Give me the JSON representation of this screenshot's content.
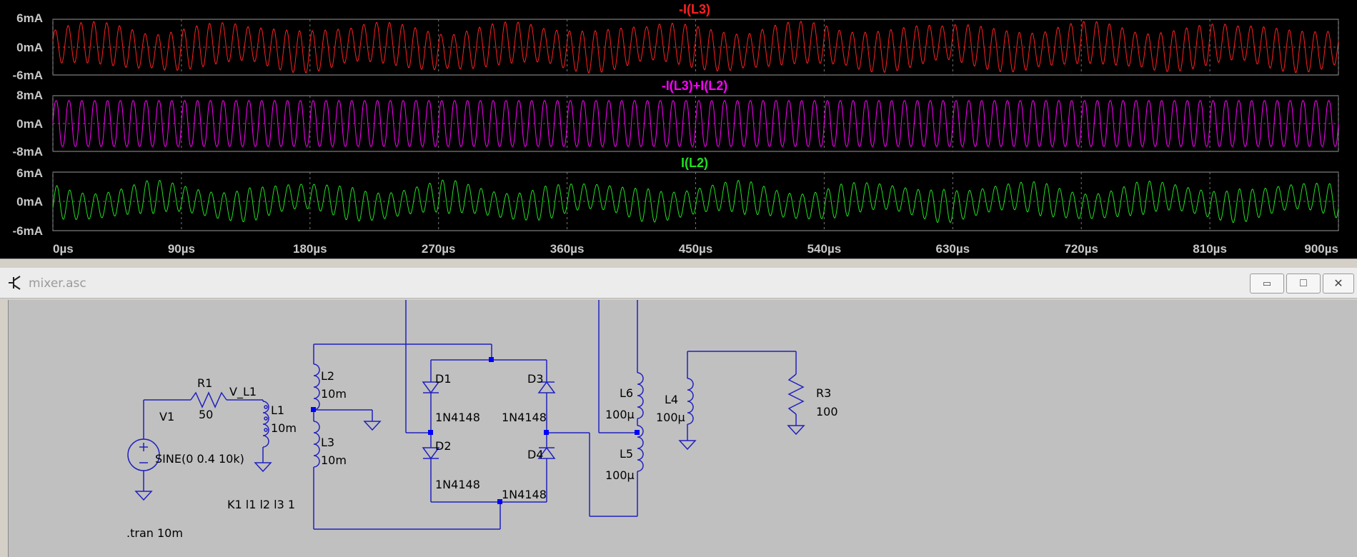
{
  "waveform": {
    "traces": [
      {
        "name": "-I(L3)",
        "color": "#ff2020",
        "y_ticks": [
          "6mA",
          "0mA",
          "-6mA"
        ],
        "amplitude_mA": 6
      },
      {
        "name": "-I(L3)+I(L2)",
        "color": "#ff00ff",
        "y_ticks": [
          "8mA",
          "0mA",
          "-8mA"
        ],
        "amplitude_mA": 8
      },
      {
        "name": "I(L2)",
        "color": "#20e020",
        "y_ticks": [
          "6mA",
          "0mA",
          "-6mA"
        ],
        "amplitude_mA": 6
      }
    ],
    "x_ticks": [
      "0µs",
      "90µs",
      "180µs",
      "270µs",
      "360µs",
      "450µs",
      "540µs",
      "630µs",
      "720µs",
      "810µs",
      "900µs"
    ],
    "x_range_us": [
      0,
      900
    ],
    "grid": "dashed"
  },
  "schematic_window": {
    "title": "mixer.asc",
    "buttons": {
      "minimize": "▭",
      "maximize": "□",
      "close": "✕"
    }
  },
  "schematic": {
    "V1": {
      "ref": "V1",
      "value": "SINE(0 0.4 10k)"
    },
    "R1": {
      "ref": "R1",
      "value": "50"
    },
    "net_label": "V_L1",
    "L1": {
      "ref": "L1",
      "value": "10m"
    },
    "L2": {
      "ref": "L2",
      "value": "10m"
    },
    "L3": {
      "ref": "L3",
      "value": "10m"
    },
    "D1": {
      "ref": "D1",
      "value": "1N4148"
    },
    "D2": {
      "ref": "D2",
      "value": "1N4148"
    },
    "D3": {
      "ref": "D3",
      "value": "1N4148"
    },
    "D4": {
      "ref": "D4",
      "value": "1N4148"
    },
    "L4": {
      "ref": "L4",
      "value": "100µ"
    },
    "L5": {
      "ref": "L5",
      "value": "100µ"
    },
    "L6": {
      "ref": "L6",
      "value": "100µ"
    },
    "R3": {
      "ref": "R3",
      "value": "100"
    },
    "coupling": "K1 l1 l2 l3 1",
    "directive": ".tran 10m",
    "wire_color": "#2020c0",
    "junction_color": "#0000ff"
  }
}
